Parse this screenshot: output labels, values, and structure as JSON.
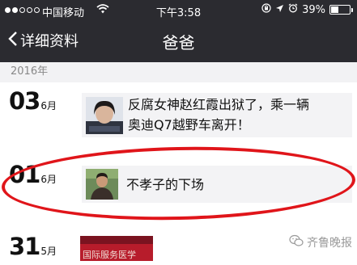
{
  "status_bar": {
    "carrier": "中国移动",
    "time": "下午3:58",
    "battery_percent": "39%",
    "signal_full_dots": 2,
    "signal_total_dots": 5
  },
  "nav": {
    "back_label": "详细资料",
    "title": "爸爸"
  },
  "year_header": "2016年",
  "entries": [
    {
      "day": "03",
      "month": "6月",
      "text_line1": "反腐女神赵红霞出狱了，乘一辆",
      "text_line2": "奥迪Q7越野车离开！"
    },
    {
      "day": "01",
      "month": "6月",
      "text_line1": "不孝子的下场"
    },
    {
      "day": "31",
      "month": "5月",
      "thumb_caption": "国际服务医学"
    }
  ],
  "watermark": "齐鲁晚报",
  "colors": {
    "topbar": "#2b2b30",
    "highlight_circle": "#e0151a",
    "card_bg": "#f3f3f5"
  }
}
